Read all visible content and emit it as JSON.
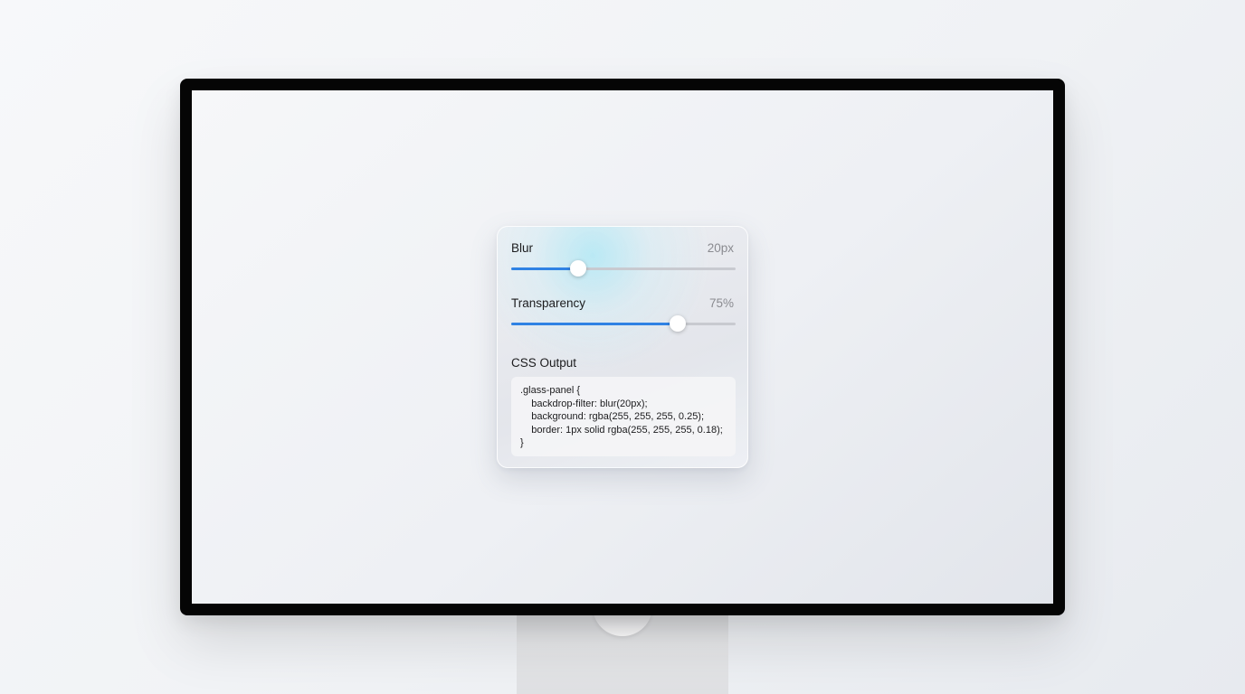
{
  "controls": {
    "blur": {
      "label": "Blur",
      "value_text": "20px",
      "fraction": 0.3
    },
    "transparency": {
      "label": "Transparency",
      "value_text": "75%",
      "fraction": 0.74
    }
  },
  "css_output": {
    "title": "CSS Output",
    "lines": [
      ".glass-panel {",
      "    backdrop-filter: blur(20px);",
      "    background: rgba(255, 255, 255, 0.25);",
      "    border: 1px solid rgba(255, 255, 255, 0.18);",
      "}"
    ]
  },
  "colors": {
    "accent": "#2f82e4",
    "bezel": "#050505"
  }
}
